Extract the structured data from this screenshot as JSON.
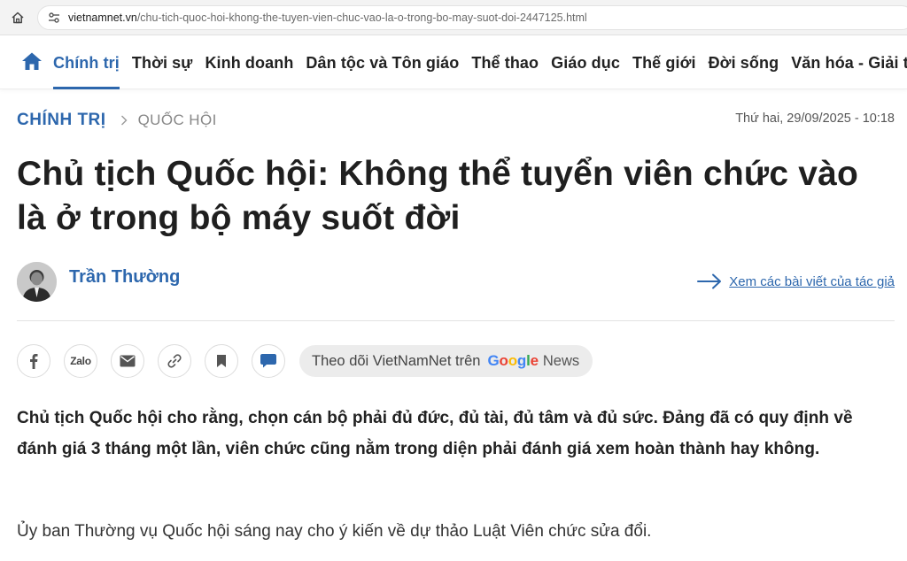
{
  "browser": {
    "url_host": "vietnamnet.vn",
    "url_path": "/chu-tich-quoc-hoi-khong-the-tuyen-vien-chuc-vao-la-o-trong-bo-may-suot-doi-2447125.html"
  },
  "nav": {
    "items": [
      {
        "label": "Chính trị",
        "active": true
      },
      {
        "label": "Thời sự"
      },
      {
        "label": "Kinh doanh"
      },
      {
        "label": "Dân tộc và Tôn giáo"
      },
      {
        "label": "Thể thao"
      },
      {
        "label": "Giáo dục"
      },
      {
        "label": "Thế giới"
      },
      {
        "label": "Đời sống"
      },
      {
        "label": "Văn hóa - Giải trí"
      }
    ]
  },
  "article": {
    "category": "CHÍNH TRỊ",
    "subcategory": "QUỐC HỘI",
    "date": "Thứ hai, 29/09/2025 - 10:18",
    "title": "Chủ tịch Quốc hội: Không thể tuyển viên chức vào là ở trong bộ máy suốt đời",
    "author": "Trần Thường",
    "author_link": "Xem các bài viết của tác giả",
    "lead": "Chủ tịch Quốc hội cho rằng, chọn cán bộ phải đủ đức, đủ tài, đủ tâm và đủ sức. Đảng đã có quy định về đánh giá 3 tháng một lần, viên chức cũng nằm trong diện phải đánh giá xem hoàn thành hay không.",
    "paragraph": "Ủy ban Thường vụ Quốc hội sáng nay cho ý kiến về dự thảo Luật Viên chức sửa đổi."
  },
  "share": {
    "zalo_label": "Zalo",
    "follow_text": "Theo dõi VietNamNet trên",
    "google_g1": "G",
    "google_o1": "o",
    "google_o2": "o",
    "google_g2": "g",
    "google_l": "l",
    "google_e": "e",
    "news_label": "News"
  },
  "colors": {
    "accent": "#2d67ad",
    "text": "#222222"
  }
}
